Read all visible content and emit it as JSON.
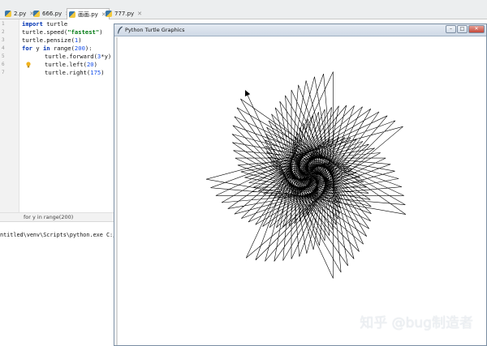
{
  "tabs": [
    {
      "label": "2.py"
    },
    {
      "label": "666.py"
    },
    {
      "label": "画画.py"
    },
    {
      "label": "777.py"
    }
  ],
  "editor": {
    "line_numbers": [
      "1",
      "2",
      "3",
      "4",
      "5",
      "6",
      "7"
    ],
    "lines": {
      "l1_kw": "import",
      "l1_rest": " turtle",
      "l2_pre": "turtle.speed(",
      "l2_str": "\"fastest\"",
      "l2_post": ")",
      "l3_pre": "turtle.pensize(",
      "l3_num": "1",
      "l3_post": ")",
      "l4_kw": "for",
      "l4_mid": " y ",
      "l4_kw2": "in",
      "l4_pre": " range(",
      "l4_num": "200",
      "l4_post": "):",
      "l5_pre": "turtle.forward(",
      "l5_num": "3",
      "l5_post": "*y)",
      "l6_pre": "turtle.left(",
      "l6_num": "20",
      "l6_post": ")",
      "l7_pre": "turtle.right(",
      "l7_num": "175",
      "l7_post": ")"
    },
    "breadcrumb": "for y in range(200)"
  },
  "console": {
    "command": "ntitled\\venv\\Scripts\\python.exe C:/"
  },
  "turtle_window": {
    "title": "Python Turtle Graphics",
    "buttons": {
      "minimize": "–",
      "maximize": "□",
      "close": "✕"
    }
  },
  "drawing": {
    "iterations": 200,
    "forward_multiplier": 3,
    "left_angle": 20,
    "right_angle": 175,
    "pensize": 1,
    "stroke_color": "#000000"
  },
  "watermark": "知乎 @bug制造者"
}
